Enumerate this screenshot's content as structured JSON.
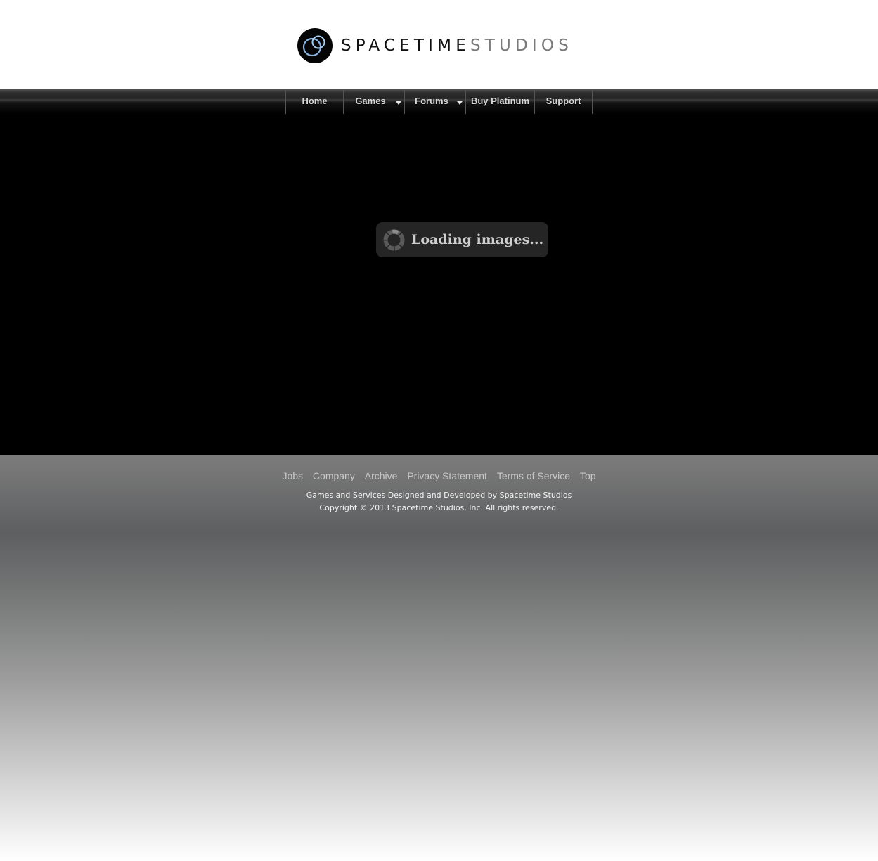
{
  "header": {
    "logo_word1": "SPACETIME",
    "logo_word2": "STUDIOS"
  },
  "nav": {
    "items": [
      {
        "label": "Home",
        "dropdown": false
      },
      {
        "label": "Games",
        "dropdown": true
      },
      {
        "label": "Forums",
        "dropdown": true
      },
      {
        "label": "Buy Platinum",
        "dropdown": false
      },
      {
        "label": "Support",
        "dropdown": false
      }
    ]
  },
  "main": {
    "loading_text": "Loading images...",
    "spinner_icon": "loading-spinner-icon"
  },
  "footer": {
    "links": [
      "Jobs",
      "Company",
      "Archive",
      "Privacy Statement",
      "Terms of Service",
      "Top"
    ],
    "line1": "Games and Services Designed and Developed by Spacetime Studios",
    "line2": "Copyright © 2013 Spacetime Studios, Inc. All rights reserved."
  },
  "colors": {
    "logo_circle": "#050505",
    "logo_ring": "#6fa8dc",
    "main_background": "#000000",
    "loading_box": "#252525"
  }
}
